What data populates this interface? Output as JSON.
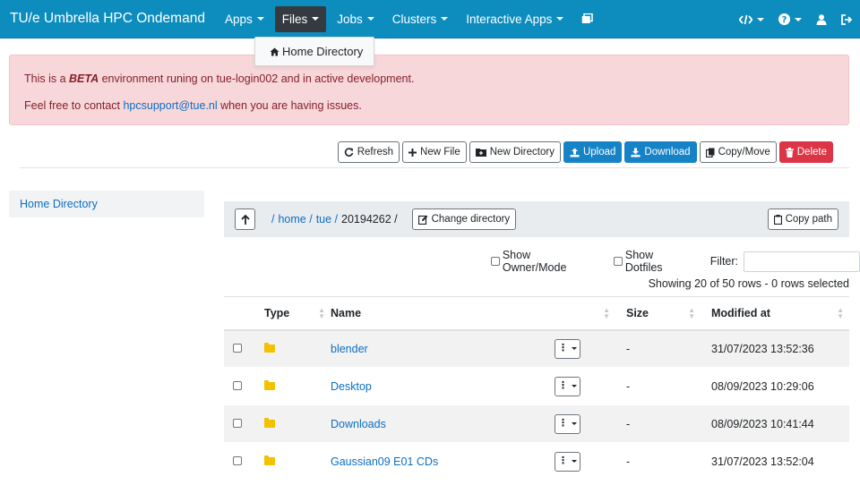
{
  "navbar": {
    "brand": "TU/e Umbrella HPC Ondemand",
    "items": [
      {
        "label": "Apps"
      },
      {
        "label": "Files"
      },
      {
        "label": "Jobs"
      },
      {
        "label": "Clusters"
      },
      {
        "label": "Interactive Apps"
      }
    ],
    "right_icons": [
      "developer-icon",
      "help-icon",
      "user-icon",
      "logout-icon"
    ]
  },
  "files_dropdown": {
    "item": "Home Directory"
  },
  "alert": {
    "prefix": "This is a ",
    "beta": "BETA",
    "suffix": " environment runing on tue-login002 and in active development.",
    "contact_prefix": "Feel free to contact ",
    "email": "hpcsupport@tue.nl",
    "contact_suffix": " when you are having issues."
  },
  "toolbar": {
    "refresh": "Refresh",
    "new_file": "New File",
    "new_directory": "New Directory",
    "upload": "Upload",
    "download": "Download",
    "copy_move": "Copy/Move",
    "delete": "Delete"
  },
  "sidebar": {
    "home": "Home Directory"
  },
  "path": {
    "root": "/",
    "segments": [
      "home /",
      "tue /",
      "20194262 /"
    ],
    "change_directory": "Change directory",
    "copy_path": "Copy path"
  },
  "options": {
    "show_owner_mode": "Show Owner/Mode",
    "show_dotfiles": "Show Dotfiles",
    "filter_label": "Filter:"
  },
  "table": {
    "summary": "Showing 20 of 50 rows - 0 rows selected",
    "headers": {
      "type": "Type",
      "name": "Name",
      "size": "Size",
      "modified": "Modified at"
    },
    "rows": [
      {
        "name": "blender",
        "size": "-",
        "modified": "31/07/2023 13:52:36"
      },
      {
        "name": "Desktop",
        "size": "-",
        "modified": "08/09/2023 10:29:06"
      },
      {
        "name": "Downloads",
        "size": "-",
        "modified": "08/09/2023 10:41:44"
      },
      {
        "name": "Gaussian09 E01 CDs",
        "size": "-",
        "modified": "31/07/2023 13:52:04"
      }
    ]
  },
  "colors": {
    "navbar": "#0c8dbe",
    "primary": "#1683c7",
    "danger": "#dc3545",
    "alert_bg": "#f8d7da"
  }
}
